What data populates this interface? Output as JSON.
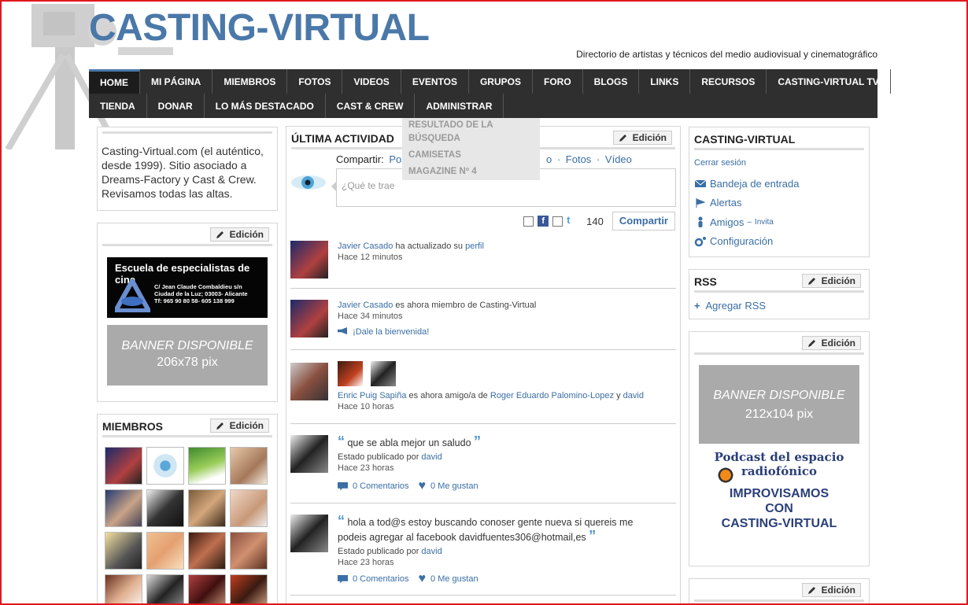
{
  "header": {
    "site_title": "CASTING-VIRTUAL",
    "tagline": "Directorio de artistas y técnicos del medio audiovisual y cinematográfico"
  },
  "nav": {
    "row1": [
      "HOME",
      "MI PÁGINA",
      "MIEMBROS",
      "FOTOS",
      "VIDEOS",
      "EVENTOS",
      "GRUPOS",
      "FORO",
      "BLOGS",
      "LINKS",
      "RECURSOS",
      "CASTING-VIRTUAL TV"
    ],
    "row2": [
      "TIENDA",
      "DONAR",
      "LO MÁS DESTACADO",
      "CAST & CREW",
      "ADMINISTRAR"
    ],
    "active": "HOME",
    "dropdown": [
      "RESULTADO DE LA BÚSQUEDA",
      "CAMISETAS",
      "MAGAZINE Nº 4"
    ]
  },
  "left": {
    "intro": "Casting-Virtual.com (el auténtico, desde 1999). Sitio asociado a Dreams-Factory y Cast & Crew. Revisamos todas las altas.",
    "edit_label": "Edición",
    "school_ad": {
      "title": "Escuela de especialistas de cine",
      "address1": "C/ Jean Claude Combaldieu s/n",
      "address2": "Ciudad de la Luz; 03003- Alicante",
      "phone": "Tf: 965 90 80 58- 605 138 999"
    },
    "banner1": {
      "line1": "BANNER DISPONIBLE",
      "line2": "206x78 pix"
    },
    "members_title": "MIEMBROS"
  },
  "activity": {
    "title": "ÚLTIMA ACTIVIDAD",
    "edit_label": "Edición",
    "share_prefix": "Compartir:",
    "share_visible_start": "Pos",
    "share_visible_end_1": "o",
    "share_sep": "·",
    "share_fotos": "Fotos",
    "share_video": "Vídeo",
    "input_placeholder": "¿Qué te trae",
    "char_count": "140",
    "share_button": "Compartir",
    "items": [
      {
        "user": "Javier Casado",
        "action": "ha actualizado su",
        "link": "perfil",
        "time": "Hace 12 minutos"
      },
      {
        "user": "Javier Casado",
        "action": "es ahora miembro de Casting-Virtual",
        "time": "Hace 34 minutos",
        "welcome": "¡Dale la bienvenida!"
      },
      {
        "user": "Enric Puig Sapiña",
        "action": "es ahora amigo/a de",
        "friend1": "Roger Eduardo Palomino-Lopez",
        "and": "y",
        "friend2": "david",
        "time": "Hace 10 horas"
      },
      {
        "quote": "que se abla mejor un saludo",
        "posted_by": "Estado publicado por",
        "user": "david",
        "time": "Hace 23 horas",
        "comments": "0 Comentarios",
        "likes": "0 Me gustan"
      },
      {
        "quote": "hola a tod@s estoy buscando conoser gente nueva si quereis me podeis agregar al facebook davidfuentes306@hotmail,es",
        "posted_by": "Estado publicado por",
        "user": "david",
        "time": "Hace 23 horas",
        "comments": "0 Comentarios",
        "likes": "0 Me gustan"
      }
    ]
  },
  "right": {
    "cv_title": "CASTING-VIRTUAL",
    "logout": "Cerrar sesión",
    "inbox": "Bandeja de entrada",
    "alerts": "Alertas",
    "friends": "Amigos",
    "friends_dash": "–",
    "invite": "Invita",
    "config": "Configuración",
    "rss_title": "RSS",
    "add_rss": "Agregar RSS",
    "edit_label": "Edición",
    "banner2": {
      "line1": "BANNER DISPONIBLE",
      "line2": "212x104 pix"
    },
    "podcast": {
      "line1": "Podcast del espacio",
      "line2": "radiofónico",
      "line3": "IMPROVISAMOS",
      "line4": "CON",
      "line5": "CASTING-VIRTUAL"
    }
  },
  "colors": {
    "brand_blue": "#4a78a8",
    "nav_bg": "#2f2f2f",
    "link": "#3a6ea5"
  }
}
